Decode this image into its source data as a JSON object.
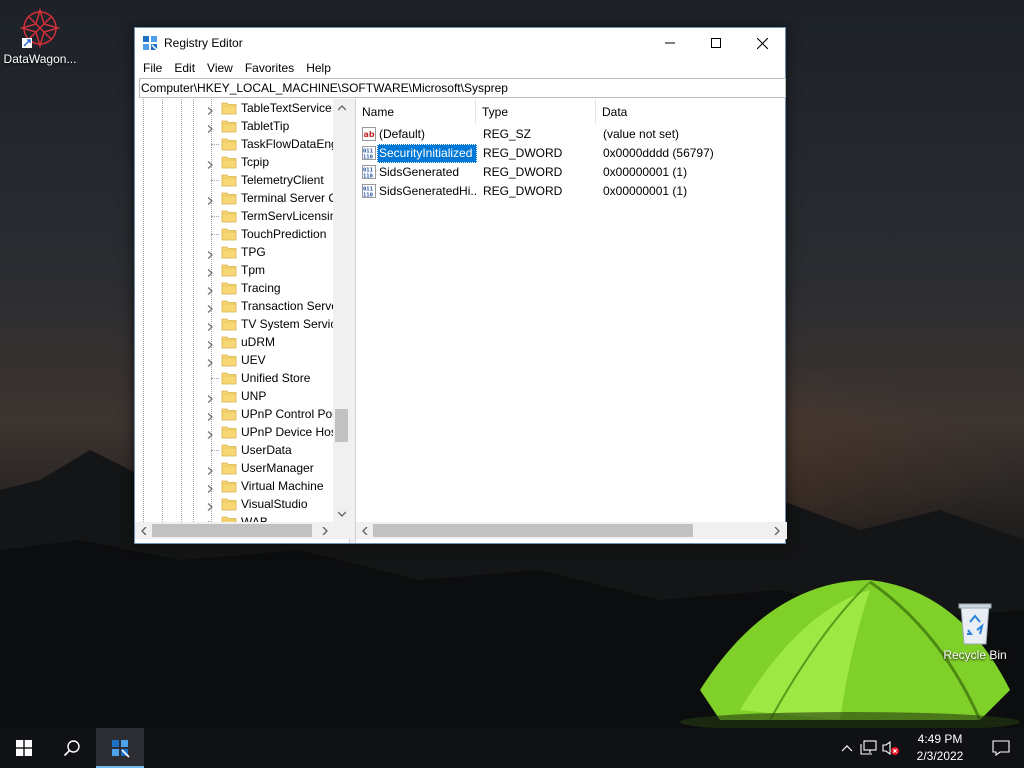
{
  "desktop": {
    "icons": [
      {
        "label": "DataWagon..."
      },
      {
        "label": "Recycle Bin"
      }
    ]
  },
  "window": {
    "title": "Registry Editor",
    "menu": [
      "File",
      "Edit",
      "View",
      "Favorites",
      "Help"
    ],
    "address": "Computer\\HKEY_LOCAL_MACHINE\\SOFTWARE\\Microsoft\\Sysprep",
    "tree": {
      "items": [
        {
          "label": "TableTextService",
          "expandable": true
        },
        {
          "label": "TabletTip",
          "expandable": true
        },
        {
          "label": "TaskFlowDataEng",
          "expandable": false
        },
        {
          "label": "Tcpip",
          "expandable": true
        },
        {
          "label": "TelemetryClient",
          "expandable": false
        },
        {
          "label": "Terminal Server C",
          "expandable": true
        },
        {
          "label": "TermServLicensin",
          "expandable": false
        },
        {
          "label": "TouchPrediction",
          "expandable": false
        },
        {
          "label": "TPG",
          "expandable": true
        },
        {
          "label": "Tpm",
          "expandable": true
        },
        {
          "label": "Tracing",
          "expandable": true
        },
        {
          "label": "Transaction Serve",
          "expandable": true
        },
        {
          "label": "TV System Service",
          "expandable": true
        },
        {
          "label": "uDRM",
          "expandable": true
        },
        {
          "label": "UEV",
          "expandable": true
        },
        {
          "label": "Unified Store",
          "expandable": false
        },
        {
          "label": "UNP",
          "expandable": true
        },
        {
          "label": "UPnP Control Poi",
          "expandable": true
        },
        {
          "label": "UPnP Device Hos",
          "expandable": true
        },
        {
          "label": "UserData",
          "expandable": false
        },
        {
          "label": "UserManager",
          "expandable": true
        },
        {
          "label": "Virtual Machine",
          "expandable": true
        },
        {
          "label": "VisualStudio",
          "expandable": true
        },
        {
          "label": "WAB",
          "expandable": true
        }
      ]
    },
    "list": {
      "columns": [
        "Name",
        "Type",
        "Data"
      ],
      "rows": [
        {
          "name": "(Default)",
          "type": "REG_SZ",
          "data": "(value not set)",
          "icon": "string-value-icon",
          "selected": false
        },
        {
          "name": "SecurityInitialized",
          "type": "REG_DWORD",
          "data": "0x0000dddd (56797)",
          "icon": "binary-value-icon",
          "selected": true
        },
        {
          "name": "SidsGenerated",
          "type": "REG_DWORD",
          "data": "0x00000001 (1)",
          "icon": "binary-value-icon",
          "selected": false
        },
        {
          "name": "SidsGeneratedHi...",
          "type": "REG_DWORD",
          "data": "0x00000001 (1)",
          "icon": "binary-value-icon",
          "selected": false
        }
      ]
    }
  },
  "taskbar": {
    "time": "4:49 PM",
    "date": "2/3/2022"
  },
  "colors": {
    "selection": "#0078d7",
    "taskbar": "#101114",
    "taskbar_active_indicator": "#76b9ed"
  }
}
